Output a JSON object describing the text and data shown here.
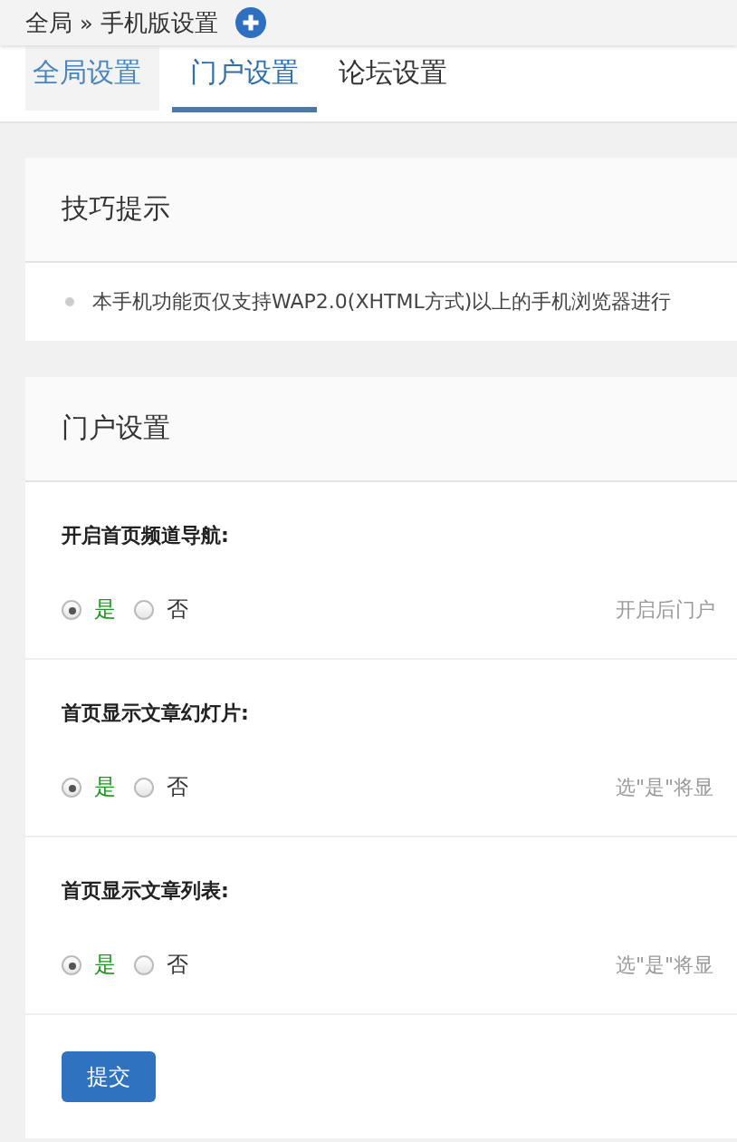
{
  "breadcrumb": {
    "items": [
      "全局",
      "»",
      "手机版设置"
    ]
  },
  "tabs": [
    {
      "label": "全局设置",
      "selected": false,
      "hovered": true
    },
    {
      "label": "门户设置",
      "selected": true,
      "hovered": false
    },
    {
      "label": "论坛设置",
      "selected": false,
      "hovered": false
    }
  ],
  "tips": {
    "title": "技巧提示",
    "items": [
      "本手机功能页仅支持WAP2.0(XHTML方式)以上的手机浏览器进行"
    ]
  },
  "settings": {
    "title": "门户设置",
    "rows": [
      {
        "label": "开启首页频道导航:",
        "options": [
          {
            "label": "是",
            "selected": true
          },
          {
            "label": "否",
            "selected": false
          }
        ],
        "hint": "开启后门户"
      },
      {
        "label": "首页显示文章幻灯片:",
        "options": [
          {
            "label": "是",
            "selected": true
          },
          {
            "label": "否",
            "selected": false
          }
        ],
        "hint": "选\"是\"将显"
      },
      {
        "label": "首页显示文章列表:",
        "options": [
          {
            "label": "是",
            "selected": true
          },
          {
            "label": "否",
            "selected": false
          }
        ],
        "hint": "选\"是\"将显"
      }
    ],
    "submit": "提交"
  }
}
